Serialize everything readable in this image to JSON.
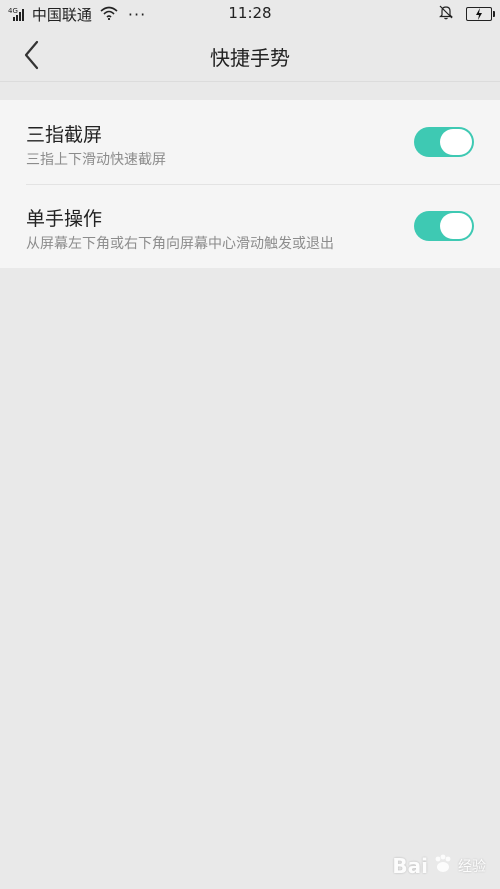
{
  "status_bar": {
    "network_type": "4G",
    "carrier": "中国联通",
    "more": "···",
    "time": "11:28",
    "icons": [
      "signal-icon",
      "wifi-icon",
      "bell-muted-icon",
      "battery-charging-icon"
    ],
    "battery_color": "#3bc27a"
  },
  "nav": {
    "back_icon": "chevron-left-icon",
    "title": "快捷手势"
  },
  "settings": [
    {
      "title": "三指截屏",
      "description": "三指上下滑动快速截屏",
      "enabled": true
    },
    {
      "title": "单手操作",
      "description": "从屏幕左下角或右下角向屏幕中心滑动触发或退出",
      "enabled": true
    }
  ],
  "colors": {
    "toggle_on": "#3ec9b3",
    "background": "#e9e9e9",
    "list_background": "#f5f5f5"
  },
  "watermark": {
    "brand": "Bai",
    "suffix": "经验"
  }
}
